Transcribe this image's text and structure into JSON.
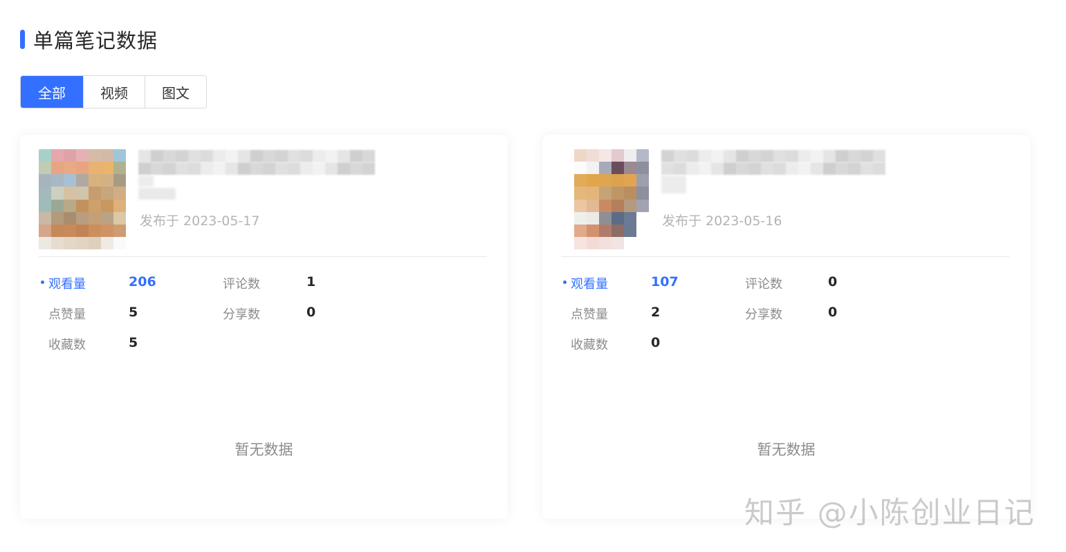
{
  "section": {
    "title": "单篇笔记数据"
  },
  "tabs": [
    {
      "label": "全部",
      "active": true
    },
    {
      "label": "视频",
      "active": false
    },
    {
      "label": "图文",
      "active": false
    }
  ],
  "notes": [
    {
      "published": "发布于 2023-05-17",
      "stats": {
        "views": {
          "label": "观看量",
          "value": "206"
        },
        "comments": {
          "label": "评论数",
          "value": "1"
        },
        "likes": {
          "label": "点赞量",
          "value": "5"
        },
        "shares": {
          "label": "分享数",
          "value": "0"
        },
        "favorites": {
          "label": "收藏数",
          "value": "5"
        }
      },
      "empty_text": "暂无数据"
    },
    {
      "published": "发布于 2023-05-16",
      "stats": {
        "views": {
          "label": "观看量",
          "value": "107"
        },
        "comments": {
          "label": "评论数",
          "value": "0"
        },
        "likes": {
          "label": "点赞量",
          "value": "2"
        },
        "shares": {
          "label": "分享数",
          "value": "0"
        },
        "favorites": {
          "label": "收藏数",
          "value": "0"
        }
      },
      "empty_text": "暂无数据"
    }
  ],
  "watermark": "知乎 @小陈创业日记",
  "colors": {
    "accent": "#3370ff"
  }
}
